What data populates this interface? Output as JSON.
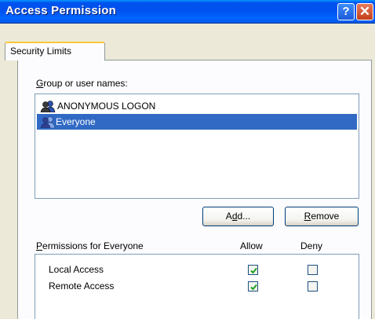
{
  "window": {
    "title": "Access Permission"
  },
  "titlebar": {
    "help_label": "?",
    "close_label": "✕"
  },
  "tabs": [
    {
      "label": "Security Limits"
    }
  ],
  "groups": {
    "label_accel": "G",
    "label_rest": "roup or user names:",
    "items": [
      {
        "name": "ANONYMOUS LOGON",
        "icon": "users-icon",
        "selected": false
      },
      {
        "name": "Everyone",
        "icon": "users-icon",
        "selected": true
      }
    ]
  },
  "buttons": {
    "add_pre": "A",
    "add_accel": "d",
    "add_post": "d...",
    "remove_accel": "R",
    "remove_post": "emove"
  },
  "permissions": {
    "label_accel": "P",
    "label_rest": "ermissions for Everyone",
    "allow_header": "Allow",
    "deny_header": "Deny",
    "rows": [
      {
        "name": "Local Access",
        "allow": true,
        "deny": false
      },
      {
        "name": "Remote Access",
        "allow": true,
        "deny": false
      }
    ]
  },
  "colors": {
    "selection": "#316AC5",
    "titlebar": "#0055E5",
    "face": "#ECE9D8"
  }
}
